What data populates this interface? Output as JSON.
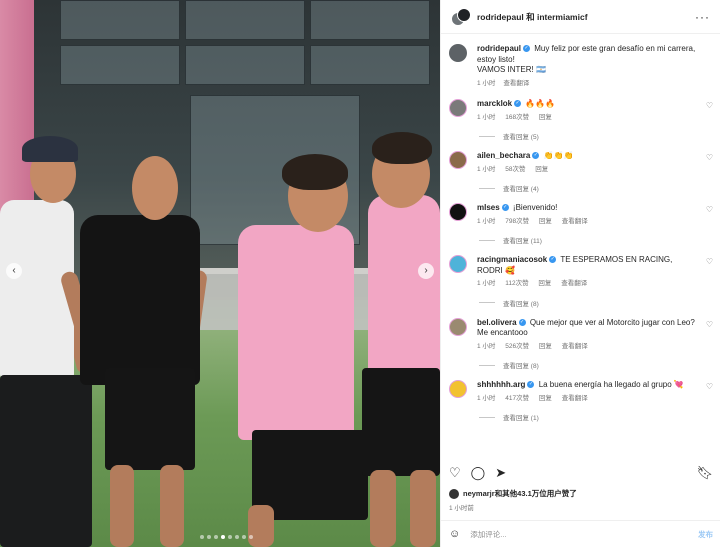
{
  "post": {
    "header_title": "rodridepaul 和 intermiamicf",
    "more_icon": "more-horizontal-icon",
    "carousel": {
      "dot_count": 8,
      "active_index": 3
    }
  },
  "caption": {
    "username": "rodridepaul",
    "text": "Muy feliz por este gran desafío en mi carrera, estoy listo!",
    "text2": "VAMOS INTER! 🇦🇷",
    "time": "1 小时",
    "translate": "查看翻译"
  },
  "comments": [
    {
      "username": "marcklok",
      "text": "🔥🔥🔥",
      "time": "1 小时",
      "likes": "168次赞",
      "reply": "回复",
      "translate": "",
      "view_replies": "查看回复 (5)",
      "avatar_color": "#7a7a7a"
    },
    {
      "username": "ailen_bechara",
      "text": "👏👏👏",
      "time": "1 小时",
      "likes": "58次赞",
      "reply": "回复",
      "translate": "",
      "view_replies": "查看回复 (4)",
      "avatar_color": "#8a6a4a"
    },
    {
      "username": "mlses",
      "text": "¡Bienvenido!",
      "time": "1 小时",
      "likes": "798次赞",
      "reply": "回复",
      "translate": "查看翻译",
      "view_replies": "查看回复 (11)",
      "avatar_color": "#111111"
    },
    {
      "username": "racingmaniacosok",
      "text": "TE ESPERAMOS EN RACING, RODRI 🥰",
      "time": "1 小时",
      "likes": "112次赞",
      "reply": "回复",
      "translate": "查看翻译",
      "view_replies": "查看回复 (8)",
      "avatar_color": "#4fb3d9"
    },
    {
      "username": "bel.olivera",
      "text": "Que mejor que ver al Motorcito jugar con Leo? Me encantooo",
      "time": "1 小时",
      "likes": "526次赞",
      "reply": "回复",
      "translate": "查看翻译",
      "view_replies": "查看回复 (8)",
      "avatar_color": "#9a8a70"
    },
    {
      "username": "shhhhhh.arg",
      "text": "La buena energía ha llegado al grupo 💘",
      "time": "1 小时",
      "likes": "417次赞",
      "reply": "回复",
      "translate": "查看翻译",
      "view_replies": "查看回复 (1)",
      "avatar_color": "#f2c230"
    }
  ],
  "actions": {
    "like_icon": "heart-icon",
    "comment_icon": "comment-icon",
    "share_icon": "send-icon",
    "save_icon": "bookmark-icon"
  },
  "likes_summary": {
    "user": "neymarjr",
    "text": "和其他43.1万位用户赞了"
  },
  "post_time": "1 小时前",
  "add_comment": {
    "placeholder": "添加评论...",
    "post_label": "发布",
    "emoji_icon": "emoji-icon"
  }
}
